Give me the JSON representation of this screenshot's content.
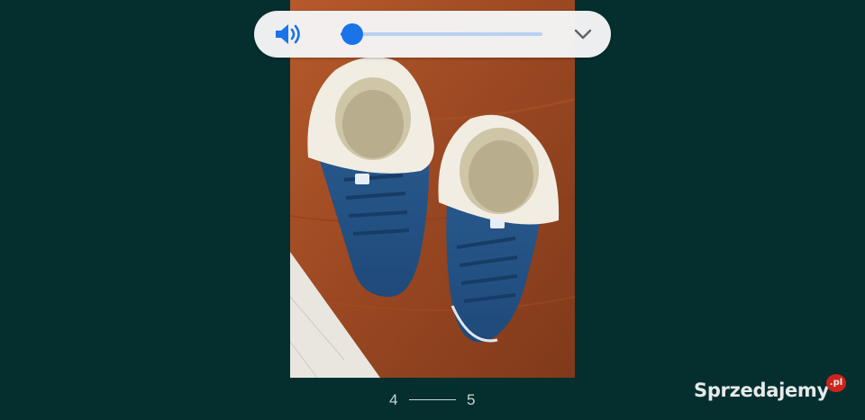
{
  "volume": {
    "level": 0.06,
    "accent_color": "#1a73e8",
    "track_color": "#b7d1f1",
    "speaker_icon": "speaker-volume-icon",
    "expand_icon": "chevron-down-icon"
  },
  "gallery": {
    "current_page": "4",
    "next_page": "5",
    "image_subject": "pair of blue suede fur-lined sneakers on wooden floor"
  },
  "watermark": {
    "brand": "Sprzedajemy",
    "tld": ".pl",
    "tld_color": "#e2231a"
  },
  "colors": {
    "background": "#042f2e"
  }
}
